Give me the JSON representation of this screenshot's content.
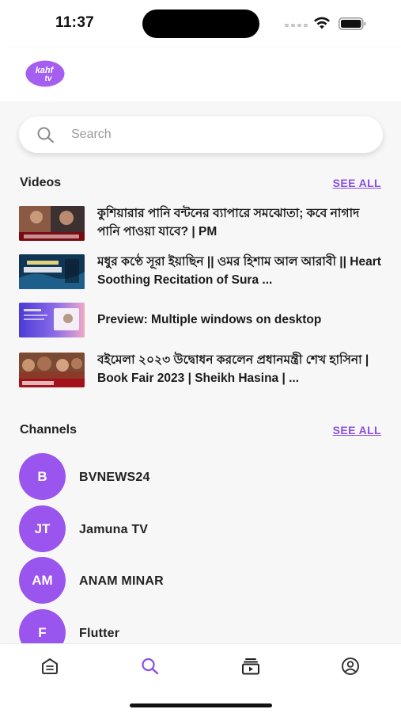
{
  "status": {
    "time": "11:37"
  },
  "header": {
    "logo_text_top": "kahf",
    "logo_text_bottom": "tv"
  },
  "search": {
    "placeholder": "Search"
  },
  "videos": {
    "title": "Videos",
    "see_all": "SEE ALL",
    "items": [
      {
        "title": "কুশিয়ারার পানি বন্টনের ব্যাপারে সমঝোতা; কবে নাগাদ পানি পাওয়া যাবে? | PM",
        "thumb_caption": "কে কুশিয়ারা কত পানি পাবে"
      },
      {
        "title": "মধুর কণ্ঠে সূরা ইয়াছিন || ওমর হিশাম আল আরাবী || Heart Soothing Recitation of Sura ...",
        "thumb_caption": "সূরা ইয়াছিন"
      },
      {
        "title": "Preview: Multiple windows on desktop",
        "thumb_caption": "Flutter"
      },
      {
        "title": "বইমেলা ২০২৩ উদ্বোধন করলেন প্রধানমন্ত্রী শেখ হাসিনা | Book Fair 2023 | Sheikh Hasina | ...",
        "thumb_caption": "বইমেলা"
      }
    ]
  },
  "channels": {
    "title": "Channels",
    "see_all": "SEE ALL",
    "items": [
      {
        "initials": "B",
        "name": "BVNEWS24"
      },
      {
        "initials": "JT",
        "name": "Jamuna TV"
      },
      {
        "initials": "AM",
        "name": "ANAM MINAR"
      },
      {
        "initials": "F",
        "name": "Flutter"
      }
    ]
  },
  "tabs": [
    {
      "icon": "home-icon",
      "active": false
    },
    {
      "icon": "search-icon",
      "active": true
    },
    {
      "icon": "library-icon",
      "active": false
    },
    {
      "icon": "profile-icon",
      "active": false
    }
  ],
  "colors": {
    "accent": "#8a4fe0",
    "avatar": "#9a55ee",
    "logo": "#a45ff0"
  }
}
